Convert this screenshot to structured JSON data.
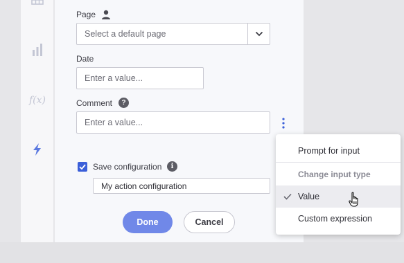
{
  "form": {
    "page_label": "Page",
    "page_placeholder": "Select a default page",
    "date_label": "Date",
    "date_placeholder": "Enter a value...",
    "comment_label": "Comment",
    "comment_placeholder": "Enter a value...",
    "save_config_label": "Save configuration",
    "save_config_checked": true,
    "config_name_value": "My action configuration",
    "done_label": "Done",
    "cancel_label": "Cancel"
  },
  "rail": {
    "icons": [
      "table-icon",
      "bar-chart-icon",
      "function-icon",
      "lightning-icon"
    ]
  },
  "menu": {
    "prompt_label": "Prompt for input",
    "header_label": "Change input type",
    "value_label": "Value",
    "custom_label": "Custom expression",
    "selected": "Value"
  },
  "colors": {
    "accent": "#3b5fd9",
    "primary_button": "#7088e8",
    "icon_lightning": "#5b79e0"
  }
}
